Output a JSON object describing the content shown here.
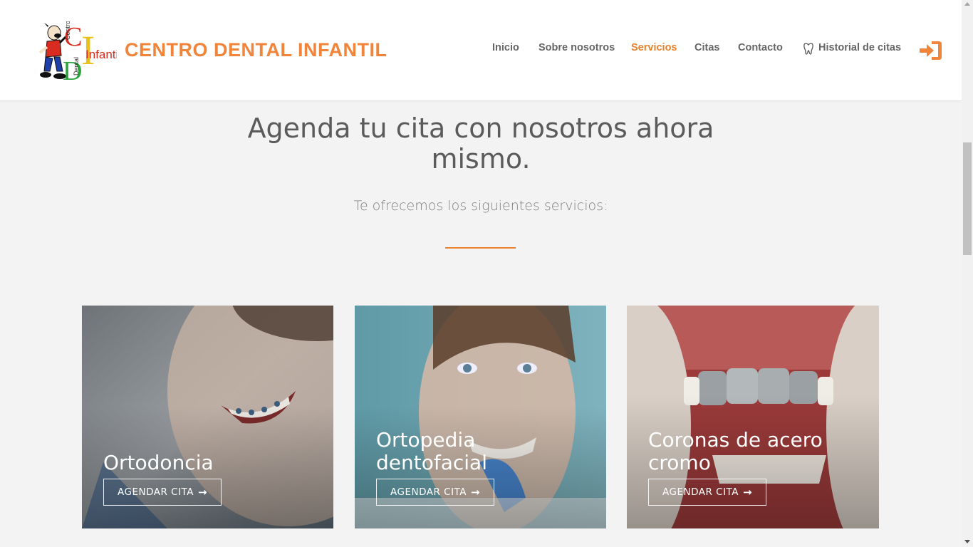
{
  "brand": {
    "name": "CENTRO DENTAL INFANTIL",
    "logo_letters": {
      "c": "C",
      "i": "I",
      "d": "D",
      "centro": "Centro",
      "infantil": "Infantil",
      "dental": "Dental"
    }
  },
  "nav": {
    "items": [
      {
        "label": "Inicio",
        "active": false
      },
      {
        "label": "Sobre nosotros",
        "active": false
      },
      {
        "label": "Servicios",
        "active": true
      },
      {
        "label": "Citas",
        "active": false
      },
      {
        "label": "Contacto",
        "active": false
      },
      {
        "label": "Historial de citas",
        "active": false,
        "icon": "tooth-icon"
      }
    ],
    "login_icon": "sign-in-icon"
  },
  "hero": {
    "headline": "Agenda tu cita con nosotros ahora mismo.",
    "subtitle": "Te ofrecemos los siguientes servicios:"
  },
  "services": [
    {
      "title": "Ortodoncia",
      "button": "AGENDAR CITA"
    },
    {
      "title": "Ortopedia dentofacial",
      "button": "AGENDAR CITA"
    },
    {
      "title": "Coronas de acero cromo",
      "button": "AGENDAR CITA"
    }
  ],
  "colors": {
    "accent": "#e8822f",
    "brand_text": "#f0843a",
    "nav_text": "#666666",
    "page_bg": "#f3f3f3"
  }
}
